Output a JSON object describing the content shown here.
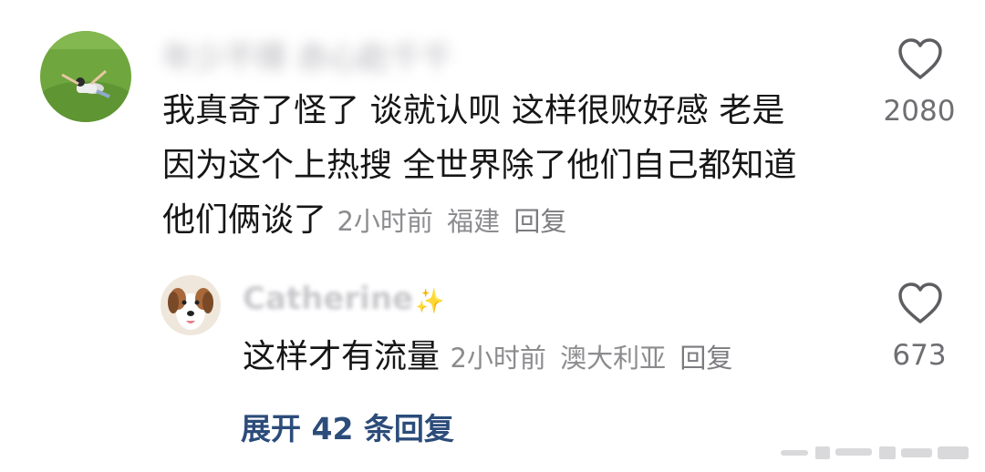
{
  "comment": {
    "username": "",
    "text_line1": "我真奇了怪了 谈就认呗 这样很败好感 老是",
    "text_line2": "因为这个上热搜 全世界除了他们自己都知道",
    "text_line3": "他们俩谈了",
    "time": "2小时前",
    "location": "福建",
    "reply_label": "回复",
    "like_count": "2080"
  },
  "reply": {
    "username": "Catherine",
    "text": "这样才有流量",
    "time": "2小时前",
    "location": "澳大利亚",
    "reply_label": "回复",
    "like_count": "673"
  },
  "expand_label": "展开 42 条回复",
  "colors": {
    "text": "#161616",
    "meta": "#8c8c8f",
    "link": "#2c4c7a",
    "count": "#6f6f73"
  }
}
